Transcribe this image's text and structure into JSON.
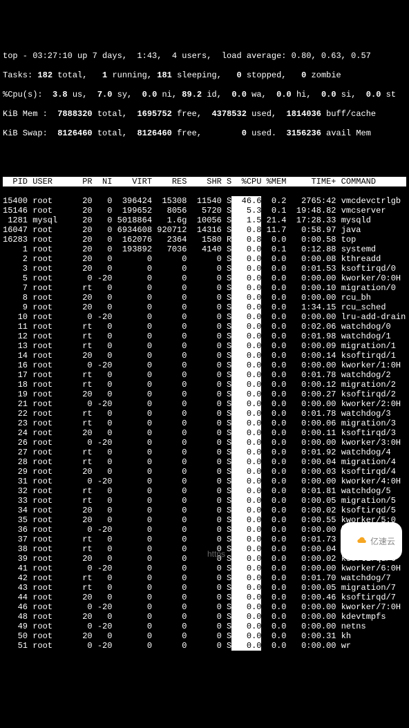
{
  "summary": {
    "line1_a": "top - 03:27:10 up 7 days,  1:43,  4 users,  load average: 0.80, 0.63, 0.57",
    "tasks_label": "Tasks:",
    "tasks_total": " 182 ",
    "tasks_total_l": "total,",
    "tasks_running": "   1 ",
    "tasks_running_l": "running,",
    "tasks_sleeping": " 181 ",
    "tasks_sleeping_l": "sleeping,",
    "tasks_stopped": "   0 ",
    "tasks_stopped_l": "stopped,",
    "tasks_zombie": "   0 ",
    "tasks_zombie_l": "zombie",
    "cpu_label": "%Cpu(s):",
    "cpu_us": "  3.8 ",
    "cpu_us_l": "us,",
    "cpu_sy": "  7.0 ",
    "cpu_sy_l": "sy,",
    "cpu_ni": "  0.0 ",
    "cpu_ni_l": "ni,",
    "cpu_id": " 89.2 ",
    "cpu_id_l": "id,",
    "cpu_wa": "  0.0 ",
    "cpu_wa_l": "wa,",
    "cpu_hi": "  0.0 ",
    "cpu_hi_l": "hi,",
    "cpu_si": "  0.0 ",
    "cpu_si_l": "si,",
    "cpu_st": "  0.0 ",
    "cpu_st_l": "st",
    "mem_label": "KiB Mem :",
    "mem_total": "  7888320 ",
    "mem_total_l": "total,",
    "mem_free": "  1695752 ",
    "mem_free_l": "free,",
    "mem_used": "  4378532 ",
    "mem_used_l": "used,",
    "mem_buff": "  1814036 ",
    "mem_buff_l": "buff/cache",
    "swap_label": "KiB Swap:",
    "swap_total": "  8126460 ",
    "swap_total_l": "total,",
    "swap_free": "  8126460 ",
    "swap_free_l": "free,",
    "swap_used": "        0 ",
    "swap_used_l": "used.",
    "swap_avail": "  3156236 ",
    "swap_avail_l": "avail Mem"
  },
  "columns": "  PID USER      PR  NI    VIRT    RES    SHR S  %CPU %MEM     TIME+ COMMAND  ",
  "rows": [
    {
      "pid": "15400",
      "user": "root",
      "pr": "20",
      "ni": "0",
      "virt": "396424",
      "res": "15308",
      "shr": "11540",
      "s": "S",
      "cpu": " 46.6",
      "mem": " 0.2",
      "time": "  2765:42",
      "cmd": "vmcdevctrlgb"
    },
    {
      "pid": "15146",
      "user": "root",
      "pr": "20",
      "ni": "0",
      "virt": "199652",
      "res": "8056",
      "shr": "5720",
      "s": "S",
      "cpu": "  5.3",
      "mem": " 0.1",
      "time": "  19:48.82",
      "cmd": "vmcserver"
    },
    {
      "pid": " 1281",
      "user": "mysql",
      "pr": "20",
      "ni": "0",
      "virt": "5018864",
      "res": "1.6g",
      "shr": "10056",
      "s": "S",
      "cpu": "  1.5",
      "mem": "21.4",
      "time": "  17:28.33",
      "cmd": "mysqld"
    },
    {
      "pid": "16047",
      "user": "root",
      "pr": "20",
      "ni": "0",
      "virt": "6934608",
      "res": "920712",
      "shr": "14316",
      "s": "S",
      "cpu": "  0.8",
      "mem": "11.7",
      "time": "   0:58.97",
      "cmd": "java"
    },
    {
      "pid": "16283",
      "user": "root",
      "pr": "20",
      "ni": "0",
      "virt": "162076",
      "res": "2364",
      "shr": "1580",
      "s": "R",
      "cpu": "  0.8",
      "mem": " 0.0",
      "time": "   0:00.58",
      "cmd": "top"
    },
    {
      "pid": "    1",
      "user": "root",
      "pr": "20",
      "ni": "0",
      "virt": "193892",
      "res": "7036",
      "shr": "4140",
      "s": "S",
      "cpu": "  0.0",
      "mem": " 0.1",
      "time": "   0:12.88",
      "cmd": "systemd"
    },
    {
      "pid": "    2",
      "user": "root",
      "pr": "20",
      "ni": "0",
      "virt": "0",
      "res": "0",
      "shr": "0",
      "s": "S",
      "cpu": "  0.0",
      "mem": " 0.0",
      "time": "   0:00.08",
      "cmd": "kthreadd"
    },
    {
      "pid": "    3",
      "user": "root",
      "pr": "20",
      "ni": "0",
      "virt": "0",
      "res": "0",
      "shr": "0",
      "s": "S",
      "cpu": "  0.0",
      "mem": " 0.0",
      "time": "   0:01.53",
      "cmd": "ksoftirqd/0"
    },
    {
      "pid": "    5",
      "user": "root",
      "pr": " 0",
      "ni": "-20",
      "virt": "0",
      "res": "0",
      "shr": "0",
      "s": "S",
      "cpu": "  0.0",
      "mem": " 0.0",
      "time": "   0:00.00",
      "cmd": "kworker/0:0H"
    },
    {
      "pid": "    7",
      "user": "root",
      "pr": "rt",
      "ni": "0",
      "virt": "0",
      "res": "0",
      "shr": "0",
      "s": "S",
      "cpu": "  0.0",
      "mem": " 0.0",
      "time": "   0:00.10",
      "cmd": "migration/0"
    },
    {
      "pid": "    8",
      "user": "root",
      "pr": "20",
      "ni": "0",
      "virt": "0",
      "res": "0",
      "shr": "0",
      "s": "S",
      "cpu": "  0.0",
      "mem": " 0.0",
      "time": "   0:00.00",
      "cmd": "rcu_bh"
    },
    {
      "pid": "    9",
      "user": "root",
      "pr": "20",
      "ni": "0",
      "virt": "0",
      "res": "0",
      "shr": "0",
      "s": "S",
      "cpu": "  0.0",
      "mem": " 0.0",
      "time": "   1:34.15",
      "cmd": "rcu_sched"
    },
    {
      "pid": "   10",
      "user": "root",
      "pr": " 0",
      "ni": "-20",
      "virt": "0",
      "res": "0",
      "shr": "0",
      "s": "S",
      "cpu": "  0.0",
      "mem": " 0.0",
      "time": "   0:00.00",
      "cmd": "lru-add-drain"
    },
    {
      "pid": "   11",
      "user": "root",
      "pr": "rt",
      "ni": "0",
      "virt": "0",
      "res": "0",
      "shr": "0",
      "s": "S",
      "cpu": "  0.0",
      "mem": " 0.0",
      "time": "   0:02.06",
      "cmd": "watchdog/0"
    },
    {
      "pid": "   12",
      "user": "root",
      "pr": "rt",
      "ni": "0",
      "virt": "0",
      "res": "0",
      "shr": "0",
      "s": "S",
      "cpu": "  0.0",
      "mem": " 0.0",
      "time": "   0:01.98",
      "cmd": "watchdog/1"
    },
    {
      "pid": "   13",
      "user": "root",
      "pr": "rt",
      "ni": "0",
      "virt": "0",
      "res": "0",
      "shr": "0",
      "s": "S",
      "cpu": "  0.0",
      "mem": " 0.0",
      "time": "   0:00.09",
      "cmd": "migration/1"
    },
    {
      "pid": "   14",
      "user": "root",
      "pr": "20",
      "ni": "0",
      "virt": "0",
      "res": "0",
      "shr": "0",
      "s": "S",
      "cpu": "  0.0",
      "mem": " 0.0",
      "time": "   0:00.14",
      "cmd": "ksoftirqd/1"
    },
    {
      "pid": "   16",
      "user": "root",
      "pr": " 0",
      "ni": "-20",
      "virt": "0",
      "res": "0",
      "shr": "0",
      "s": "S",
      "cpu": "  0.0",
      "mem": " 0.0",
      "time": "   0:00.00",
      "cmd": "kworker/1:0H"
    },
    {
      "pid": "   17",
      "user": "root",
      "pr": "rt",
      "ni": "0",
      "virt": "0",
      "res": "0",
      "shr": "0",
      "s": "S",
      "cpu": "  0.0",
      "mem": " 0.0",
      "time": "   0:01.78",
      "cmd": "watchdog/2"
    },
    {
      "pid": "   18",
      "user": "root",
      "pr": "rt",
      "ni": "0",
      "virt": "0",
      "res": "0",
      "shr": "0",
      "s": "S",
      "cpu": "  0.0",
      "mem": " 0.0",
      "time": "   0:00.12",
      "cmd": "migration/2"
    },
    {
      "pid": "   19",
      "user": "root",
      "pr": "20",
      "ni": "0",
      "virt": "0",
      "res": "0",
      "shr": "0",
      "s": "S",
      "cpu": "  0.0",
      "mem": " 0.0",
      "time": "   0:00.27",
      "cmd": "ksoftirqd/2"
    },
    {
      "pid": "   21",
      "user": "root",
      "pr": " 0",
      "ni": "-20",
      "virt": "0",
      "res": "0",
      "shr": "0",
      "s": "S",
      "cpu": "  0.0",
      "mem": " 0.0",
      "time": "   0:00.00",
      "cmd": "kworker/2:0H"
    },
    {
      "pid": "   22",
      "user": "root",
      "pr": "rt",
      "ni": "0",
      "virt": "0",
      "res": "0",
      "shr": "0",
      "s": "S",
      "cpu": "  0.0",
      "mem": " 0.0",
      "time": "   0:01.78",
      "cmd": "watchdog/3"
    },
    {
      "pid": "   23",
      "user": "root",
      "pr": "rt",
      "ni": "0",
      "virt": "0",
      "res": "0",
      "shr": "0",
      "s": "S",
      "cpu": "  0.0",
      "mem": " 0.0",
      "time": "   0:00.06",
      "cmd": "migration/3"
    },
    {
      "pid": "   24",
      "user": "root",
      "pr": "20",
      "ni": "0",
      "virt": "0",
      "res": "0",
      "shr": "0",
      "s": "S",
      "cpu": "  0.0",
      "mem": " 0.0",
      "time": "   0:00.11",
      "cmd": "ksoftirqd/3"
    },
    {
      "pid": "   26",
      "user": "root",
      "pr": " 0",
      "ni": "-20",
      "virt": "0",
      "res": "0",
      "shr": "0",
      "s": "S",
      "cpu": "  0.0",
      "mem": " 0.0",
      "time": "   0:00.00",
      "cmd": "kworker/3:0H"
    },
    {
      "pid": "   27",
      "user": "root",
      "pr": "rt",
      "ni": "0",
      "virt": "0",
      "res": "0",
      "shr": "0",
      "s": "S",
      "cpu": "  0.0",
      "mem": " 0.0",
      "time": "   0:01.92",
      "cmd": "watchdog/4"
    },
    {
      "pid": "   28",
      "user": "root",
      "pr": "rt",
      "ni": "0",
      "virt": "0",
      "res": "0",
      "shr": "0",
      "s": "S",
      "cpu": "  0.0",
      "mem": " 0.0",
      "time": "   0:00.04",
      "cmd": "migration/4"
    },
    {
      "pid": "   29",
      "user": "root",
      "pr": "20",
      "ni": "0",
      "virt": "0",
      "res": "0",
      "shr": "0",
      "s": "S",
      "cpu": "  0.0",
      "mem": " 0.0",
      "time": "   0:00.03",
      "cmd": "ksoftirqd/4"
    },
    {
      "pid": "   31",
      "user": "root",
      "pr": " 0",
      "ni": "-20",
      "virt": "0",
      "res": "0",
      "shr": "0",
      "s": "S",
      "cpu": "  0.0",
      "mem": " 0.0",
      "time": "   0:00.00",
      "cmd": "kworker/4:0H"
    },
    {
      "pid": "   32",
      "user": "root",
      "pr": "rt",
      "ni": "0",
      "virt": "0",
      "res": "0",
      "shr": "0",
      "s": "S",
      "cpu": "  0.0",
      "mem": " 0.0",
      "time": "   0:01.81",
      "cmd": "watchdog/5"
    },
    {
      "pid": "   33",
      "user": "root",
      "pr": "rt",
      "ni": "0",
      "virt": "0",
      "res": "0",
      "shr": "0",
      "s": "S",
      "cpu": "  0.0",
      "mem": " 0.0",
      "time": "   0:00.05",
      "cmd": "migration/5"
    },
    {
      "pid": "   34",
      "user": "root",
      "pr": "20",
      "ni": "0",
      "virt": "0",
      "res": "0",
      "shr": "0",
      "s": "S",
      "cpu": "  0.0",
      "mem": " 0.0",
      "time": "   0:00.02",
      "cmd": "ksoftirqd/5"
    },
    {
      "pid": "   35",
      "user": "root",
      "pr": "20",
      "ni": "0",
      "virt": "0",
      "res": "0",
      "shr": "0",
      "s": "S",
      "cpu": "  0.0",
      "mem": " 0.0",
      "time": "   0:00.55",
      "cmd": "kworker/5:0"
    },
    {
      "pid": "   36",
      "user": "root",
      "pr": " 0",
      "ni": "-20",
      "virt": "0",
      "res": "0",
      "shr": "0",
      "s": "S",
      "cpu": "  0.0",
      "mem": " 0.0",
      "time": "   0:00.00",
      "cmd": "kworker/5:0H"
    },
    {
      "pid": "   37",
      "user": "root",
      "pr": "rt",
      "ni": "0",
      "virt": "0",
      "res": "0",
      "shr": "0",
      "s": "S",
      "cpu": "  0.0",
      "mem": " 0.0",
      "time": "   0:01.73",
      "cmd": "watchdog/6"
    },
    {
      "pid": "   38",
      "user": "root",
      "pr": "rt",
      "ni": "0",
      "virt": "0",
      "res": "0",
      "shr": "0",
      "s": "S",
      "cpu": "  0.0",
      "mem": " 0.0",
      "time": "   0:00.04",
      "cmd": "migration/6"
    },
    {
      "pid": "   39",
      "user": "root",
      "pr": "20",
      "ni": "0",
      "virt": "0",
      "res": "0",
      "shr": "0",
      "s": "S",
      "cpu": "  0.0",
      "mem": " 0.0",
      "time": "   0:00.02",
      "cmd": "ksoftirqd/6"
    },
    {
      "pid": "   41",
      "user": "root",
      "pr": " 0",
      "ni": "-20",
      "virt": "0",
      "res": "0",
      "shr": "0",
      "s": "S",
      "cpu": "  0.0",
      "mem": " 0.0",
      "time": "   0:00.00",
      "cmd": "kworker/6:0H"
    },
    {
      "pid": "   42",
      "user": "root",
      "pr": "rt",
      "ni": "0",
      "virt": "0",
      "res": "0",
      "shr": "0",
      "s": "S",
      "cpu": "  0.0",
      "mem": " 0.0",
      "time": "   0:01.70",
      "cmd": "watchdog/7"
    },
    {
      "pid": "   43",
      "user": "root",
      "pr": "rt",
      "ni": "0",
      "virt": "0",
      "res": "0",
      "shr": "0",
      "s": "S",
      "cpu": "  0.0",
      "mem": " 0.0",
      "time": "   0:00.05",
      "cmd": "migration/7"
    },
    {
      "pid": "   44",
      "user": "root",
      "pr": "20",
      "ni": "0",
      "virt": "0",
      "res": "0",
      "shr": "0",
      "s": "S",
      "cpu": "  0.0",
      "mem": " 0.0",
      "time": "   0:00.46",
      "cmd": "ksoftirqd/7"
    },
    {
      "pid": "   46",
      "user": "root",
      "pr": " 0",
      "ni": "-20",
      "virt": "0",
      "res": "0",
      "shr": "0",
      "s": "S",
      "cpu": "  0.0",
      "mem": " 0.0",
      "time": "   0:00.00",
      "cmd": "kworker/7:0H"
    },
    {
      "pid": "   48",
      "user": "root",
      "pr": "20",
      "ni": "0",
      "virt": "0",
      "res": "0",
      "shr": "0",
      "s": "S",
      "cpu": "  0.0",
      "mem": " 0.0",
      "time": "   0:00.00",
      "cmd": "kdevtmpfs"
    },
    {
      "pid": "   49",
      "user": "root",
      "pr": " 0",
      "ni": "-20",
      "virt": "0",
      "res": "0",
      "shr": "0",
      "s": "S",
      "cpu": "  0.0",
      "mem": " 0.0",
      "time": "   0:00.00",
      "cmd": "netns"
    },
    {
      "pid": "   50",
      "user": "root",
      "pr": "20",
      "ni": "0",
      "virt": "0",
      "res": "0",
      "shr": "0",
      "s": "S",
      "cpu": "  0.0",
      "mem": " 0.0",
      "time": "   0:00.31",
      "cmd": "kh"
    },
    {
      "pid": "   51",
      "user": "root",
      "pr": " 0",
      "ni": "-20",
      "virt": "0",
      "res": "0",
      "shr": "0",
      "s": "S",
      "cpu": "  0.0",
      "mem": " 0.0",
      "time": "   0:00.00",
      "cmd": "wr"
    }
  ],
  "watermark": "亿速云",
  "faded": "https"
}
